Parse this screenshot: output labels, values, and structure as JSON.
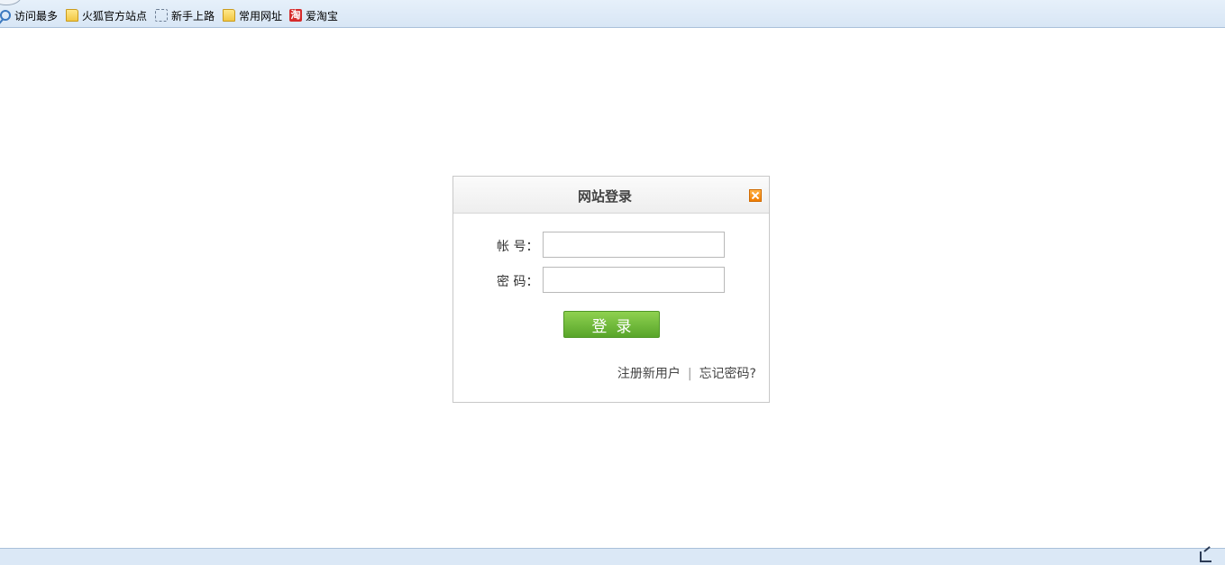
{
  "bookmarks": [
    {
      "label": "访问最多",
      "icon": "search-icon"
    },
    {
      "label": "火狐官方站点",
      "icon": "folder-icon"
    },
    {
      "label": "新手上路",
      "icon": "dotted-square-icon"
    },
    {
      "label": "常用网址",
      "icon": "folder-icon"
    },
    {
      "label": "爱淘宝",
      "icon": "taobao-icon",
      "icon_text": "淘"
    }
  ],
  "login": {
    "title": "网站登录",
    "account_label": "帐 号：",
    "account_value": "",
    "password_label": "密 码：",
    "password_value": "",
    "submit_label": "登录",
    "register_link": "注册新用户",
    "separator": "|",
    "forgot_link": "忘记密码?"
  },
  "colors": {
    "bookmark_bar_bg": "#dde9f6",
    "login_button": "#6cbb36",
    "close_button": "#f07d00",
    "taobao_red": "#d52b2b"
  }
}
